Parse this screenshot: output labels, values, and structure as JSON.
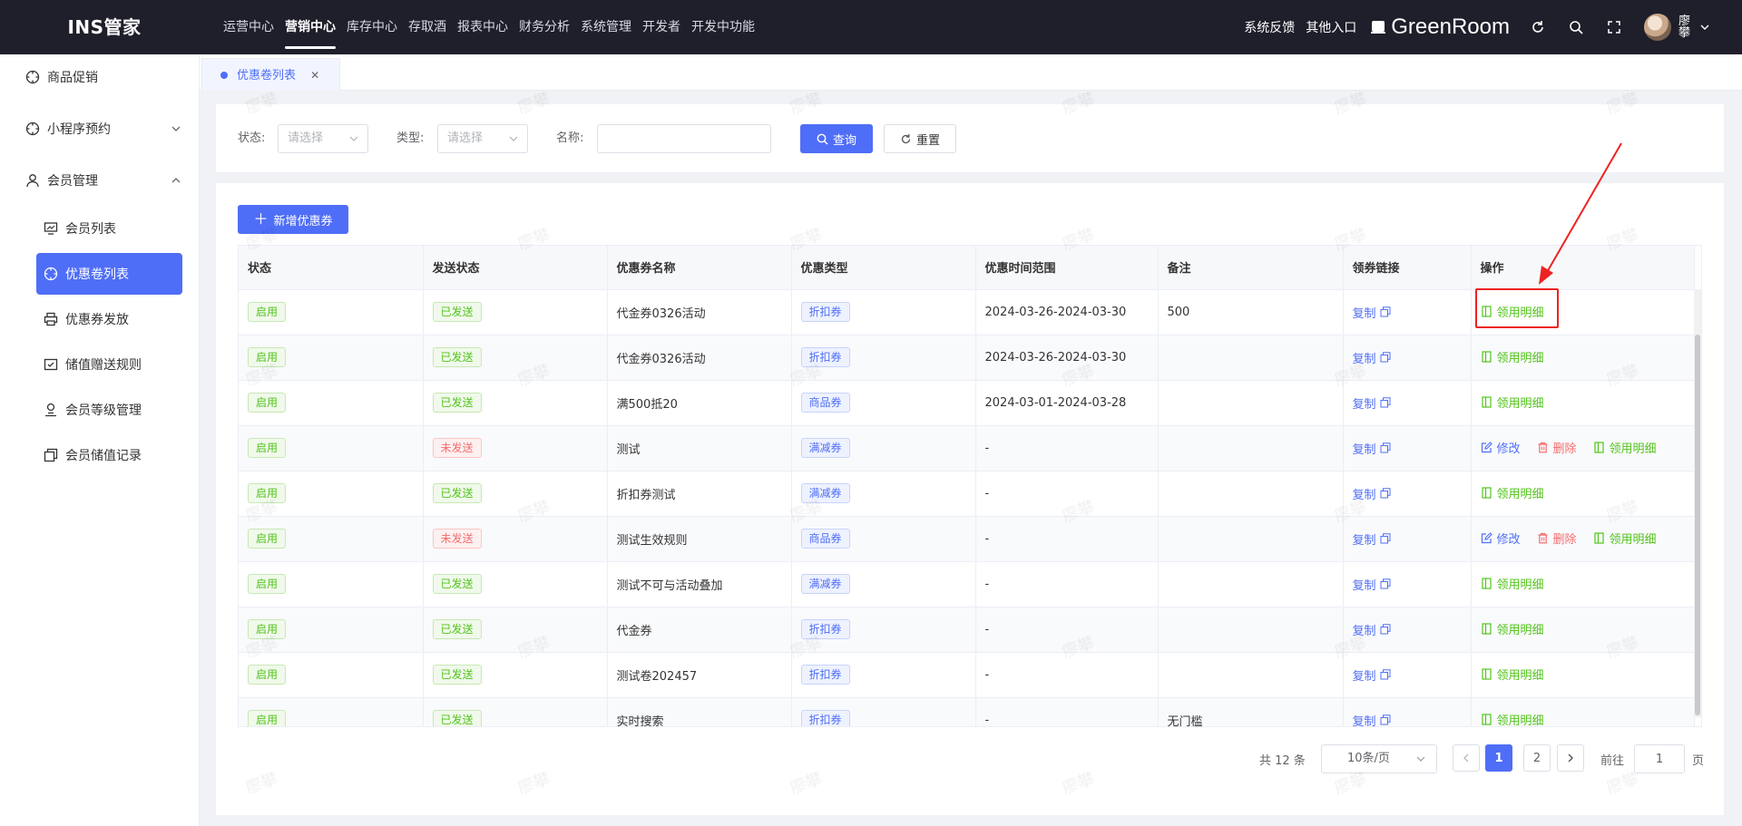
{
  "app": {
    "logo": "INS管家"
  },
  "topnav": [
    {
      "label": "运营中心",
      "active": false
    },
    {
      "label": "营销中心",
      "active": true
    },
    {
      "label": "库存中心",
      "active": false
    },
    {
      "label": "存取酒",
      "active": false
    },
    {
      "label": "报表中心",
      "active": false
    },
    {
      "label": "财务分析",
      "active": false
    },
    {
      "label": "系统管理",
      "active": false
    },
    {
      "label": "开发者",
      "active": false
    },
    {
      "label": "开发中功能",
      "active": false
    }
  ],
  "header": {
    "feedback": "系统反馈",
    "other_entry": "其他入口",
    "store_name": "GreenRoom",
    "user_name": "廖攀"
  },
  "sidebar": {
    "menus": [
      {
        "label": "商品促销",
        "icon": "target-icon"
      },
      {
        "label": "小程序预约",
        "icon": "target-icon"
      },
      {
        "label": "会员管理",
        "icon": "user-icon"
      }
    ],
    "submenus": [
      {
        "label": "会员列表",
        "icon": "chart-icon",
        "active": false
      },
      {
        "label": "优惠卷列表",
        "icon": "target-icon",
        "active": true
      },
      {
        "label": "优惠券发放",
        "icon": "printer-icon",
        "active": false
      },
      {
        "label": "储值赠送规则",
        "icon": "check-box-icon",
        "active": false
      },
      {
        "label": "会员等级管理",
        "icon": "user-pin-icon",
        "active": false
      },
      {
        "label": "会员储值记录",
        "icon": "copy-icon",
        "active": false
      }
    ]
  },
  "tabs": [
    {
      "label": "优惠卷列表"
    }
  ],
  "filter": {
    "status_label": "状态:",
    "status_placeholder": "请选择",
    "type_label": "类型:",
    "type_placeholder": "请选择",
    "name_label": "名称:",
    "name_value": "",
    "query_button": "查询",
    "reset_button": "重置"
  },
  "toolbar": {
    "add_button": "新增优惠券"
  },
  "table": {
    "columns": [
      "状态",
      "发送状态",
      "优惠券名称",
      "优惠类型",
      "优惠时间范围",
      "备注",
      "领券链接",
      "操作"
    ],
    "copy_label": "复制",
    "op_edit": "修改",
    "op_delete": "删除",
    "op_detail": "领用明细",
    "rows": [
      {
        "status": "启用",
        "send": "已发送",
        "send_ok": true,
        "name": "代金券0326活动",
        "type": "折扣券",
        "range": "2024-03-26-2024-03-30",
        "remark": "500",
        "editable": false
      },
      {
        "status": "启用",
        "send": "已发送",
        "send_ok": true,
        "name": "代金券0326活动",
        "type": "折扣券",
        "range": "2024-03-26-2024-03-30",
        "remark": "",
        "editable": false
      },
      {
        "status": "启用",
        "send": "已发送",
        "send_ok": true,
        "name": "满500抵20",
        "type": "商品券",
        "range": "2024-03-01-2024-03-28",
        "remark": "",
        "editable": false
      },
      {
        "status": "启用",
        "send": "未发送",
        "send_ok": false,
        "name": "测试",
        "type": "满减券",
        "range": "-",
        "remark": "",
        "editable": true
      },
      {
        "status": "启用",
        "send": "已发送",
        "send_ok": true,
        "name": "折扣券测试",
        "type": "满减券",
        "range": "-",
        "remark": "",
        "editable": false
      },
      {
        "status": "启用",
        "send": "未发送",
        "send_ok": false,
        "name": "测试生效规则",
        "type": "商品券",
        "range": "-",
        "remark": "",
        "editable": true
      },
      {
        "status": "启用",
        "send": "已发送",
        "send_ok": true,
        "name": "测试不可与活动叠加",
        "type": "满减券",
        "range": "-",
        "remark": "",
        "editable": false
      },
      {
        "status": "启用",
        "send": "已发送",
        "send_ok": true,
        "name": "代金券",
        "type": "折扣券",
        "range": "-",
        "remark": "",
        "editable": false
      },
      {
        "status": "启用",
        "send": "已发送",
        "send_ok": true,
        "name": "测试卷202457",
        "type": "折扣券",
        "range": "-",
        "remark": "",
        "editable": false
      },
      {
        "status": "启用",
        "send": "已发送",
        "send_ok": true,
        "name": "实时搜索",
        "type": "折扣券",
        "range": "-",
        "remark": "无门槛",
        "editable": false
      }
    ]
  },
  "pagination": {
    "total": "共 12 条",
    "page_size": "10条/页",
    "pages": [
      "1",
      "2"
    ],
    "current": "1",
    "goto_label": "前往",
    "goto_value": "1",
    "goto_unit": "页"
  },
  "watermark": "廖攀",
  "colors": {
    "accent": "#4f6ef7",
    "success": "#52c41a",
    "danger": "#f56c6c",
    "header_bg": "#1f1f2b",
    "annotation": "#ee2222"
  }
}
